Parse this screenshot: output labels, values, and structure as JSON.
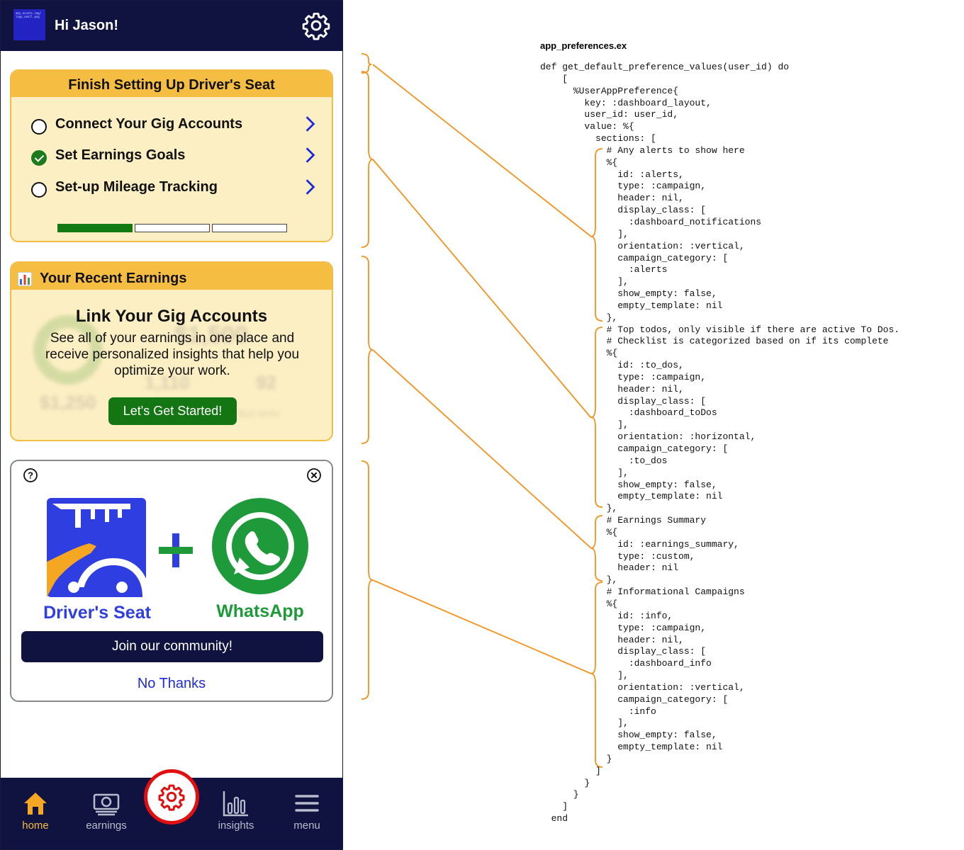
{
  "app": {
    "greeting": "Hi Jason!",
    "logo_alt": "amy.assets.img/ logo_small.png"
  },
  "setup_card": {
    "title": "Finish Setting Up Driver's Seat",
    "tasks": [
      {
        "label": "Connect Your Gig Accounts",
        "done": false
      },
      {
        "label": "Set Earnings Goals",
        "done": true
      },
      {
        "label": "Set-up Mileage Tracking",
        "done": false
      }
    ],
    "progress": {
      "completed": 1,
      "total": 3
    }
  },
  "earnings_card": {
    "title": "Your Recent Earnings",
    "heading": "Link Your Gig Accounts",
    "body": "See all of your earnings in one place and receive personalized insights that help you optimize your work.",
    "button": "Let's Get Started!",
    "blurred_values": [
      "$1,500",
      "$1,250",
      "1,110",
      "92",
      "$16.30/hr"
    ]
  },
  "community_card": {
    "left_logo_text": "Driver's Seat",
    "right_logo_text": "WhatsApp",
    "join_button": "Join our community!",
    "dismiss_link": "No Thanks"
  },
  "nav": {
    "items": [
      {
        "label": "home",
        "icon": "home-icon",
        "active": true
      },
      {
        "label": "earnings",
        "icon": "cash-icon",
        "active": false
      },
      {
        "label": "insights",
        "icon": "bar-chart-icon",
        "active": false
      },
      {
        "label": "menu",
        "icon": "hamburger-icon",
        "active": false
      }
    ],
    "center_icon": "gear-icon"
  },
  "colors": {
    "navy": "#101340",
    "card_yellow": "#f5bd42",
    "card_cream": "#fdefc4",
    "green": "#137613",
    "link_blue": "#1f2ad8",
    "highlight_red": "#e10f0f",
    "annotation_orange": "#f5921e",
    "whatsapp_green": "#25a244"
  },
  "code": {
    "filename": "app_preferences.ex",
    "lines": [
      "def get_default_preference_values(user_id) do",
      "    [",
      "      %UserAppPreference{",
      "        key: :dashboard_layout,",
      "        user_id: user_id,",
      "        value: %{",
      "          sections: [",
      "            # Any alerts to show here",
      "            %{",
      "              id: :alerts,",
      "              type: :campaign,",
      "              header: nil,",
      "              display_class: [",
      "                :dashboard_notifications",
      "              ],",
      "              orientation: :vertical,",
      "              campaign_category: [",
      "                :alerts",
      "              ],",
      "              show_empty: false,",
      "              empty_template: nil",
      "            },",
      "            # Top todos, only visible if there are active To Dos.",
      "            # Checklist is categorized based on if its complete",
      "            %{",
      "              id: :to_dos,",
      "              type: :campaign,",
      "              header: nil,",
      "              display_class: [",
      "                :dashboard_toDos",
      "              ],",
      "              orientation: :horizontal,",
      "              campaign_category: [",
      "                :to_dos",
      "              ],",
      "              show_empty: false,",
      "              empty_template: nil",
      "            },",
      "            # Earnings Summary",
      "            %{",
      "              id: :earnings_summary,",
      "              type: :custom,",
      "              header: nil",
      "            },",
      "            # Informational Campaigns",
      "            %{",
      "              id: :info,",
      "              type: :campaign,",
      "              header: nil,",
      "              display_class: [",
      "                :dashboard_info",
      "              ],",
      "              orientation: :vertical,",
      "              campaign_category: [",
      "                :info",
      "              ],",
      "              show_empty: false,",
      "              empty_template: nil",
      "            }",
      "          ]",
      "        }",
      "      }",
      "    ]",
      "  end"
    ]
  }
}
